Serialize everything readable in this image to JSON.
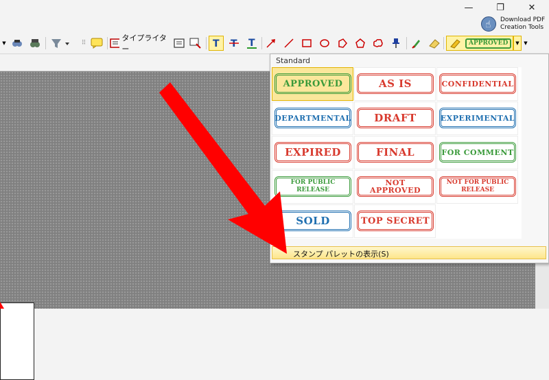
{
  "titlebar": {
    "download_line1": "Download PDF",
    "download_line2": "Creation Tools"
  },
  "toolbar": {
    "typewriter_label": "タイプライター"
  },
  "toolbar_stamp": {
    "label": "APPROVED"
  },
  "dropdown": {
    "header": "Standard",
    "stamps": [
      {
        "label": "APPROVED",
        "color": "#3a9a3a"
      },
      {
        "label": "AS IS",
        "color": "#d83a2e"
      },
      {
        "label": "CONFIDENTIAL",
        "color": "#d83a2e"
      },
      {
        "label": "DEPARTMENTAL",
        "color": "#1f6fb0"
      },
      {
        "label": "DRAFT",
        "color": "#d83a2e"
      },
      {
        "label": "EXPERIMENTAL",
        "color": "#1f6fb0"
      },
      {
        "label": "EXPIRED",
        "color": "#d83a2e"
      },
      {
        "label": "FINAL",
        "color": "#d83a2e"
      },
      {
        "label": "FOR COMMENT",
        "color": "#3a9a3a"
      },
      {
        "label": "FOR PUBLIC RELEASE",
        "color": "#3a9a3a"
      },
      {
        "label": "NOT APPROVED",
        "color": "#d83a2e"
      },
      {
        "label": "NOT FOR PUBLIC RELEASE",
        "color": "#d83a2e"
      },
      {
        "label": "SOLD",
        "color": "#1f6fb0"
      },
      {
        "label": "TOP SECRET",
        "color": "#d83a2e"
      }
    ],
    "palette_link_label": "スタンプ パレットの表示(S)"
  },
  "accent_colors": {
    "selected": "#fbe79b",
    "arrow": "#ff0000"
  }
}
